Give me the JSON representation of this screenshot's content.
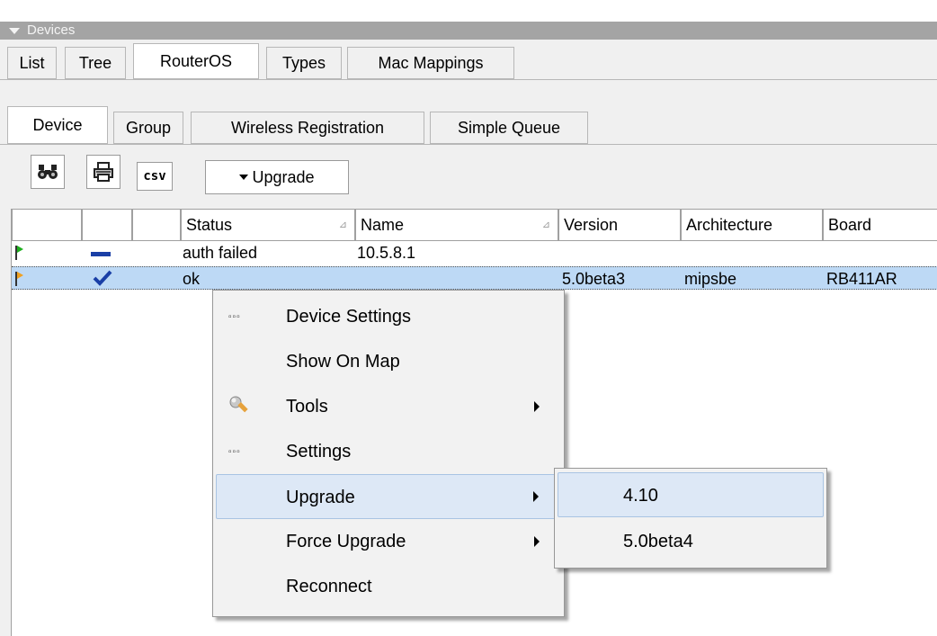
{
  "window": {
    "title": "Devices"
  },
  "tabs": [
    {
      "label": "List",
      "active": false
    },
    {
      "label": "Tree",
      "active": false
    },
    {
      "label": "RouterOS",
      "active": true
    },
    {
      "label": "Types",
      "active": false
    },
    {
      "label": "Mac Mappings",
      "active": false
    }
  ],
  "subtabs": [
    {
      "label": "Device",
      "active": true
    },
    {
      "label": "Group",
      "active": false
    },
    {
      "label": "Wireless Registration",
      "active": false
    },
    {
      "label": "Simple Queue",
      "active": false
    }
  ],
  "toolbar": {
    "find_icon": "binoculars-icon",
    "print_icon": "printer-icon",
    "csv_label": "csv",
    "upgrade_label": "Upgrade"
  },
  "table": {
    "columns": [
      "Status",
      "Name",
      "Version",
      "Architecture",
      "Board"
    ],
    "rows": [
      {
        "flag_color": "#1fb01f",
        "state_icon": "dash-icon",
        "status": "auth failed",
        "name": "10.5.8.1",
        "version": "",
        "architecture": "",
        "board": ""
      },
      {
        "flag_color": "#f0a020",
        "state_icon": "check-icon",
        "status": "ok",
        "name": "",
        "version": "5.0beta3",
        "architecture": "mipsbe",
        "board": "RB411AR"
      }
    ]
  },
  "context_menu": {
    "items": [
      {
        "label": "Device Settings",
        "icon": "dots-icon",
        "submenu": false
      },
      {
        "label": "Show On Map",
        "icon": "",
        "submenu": false
      },
      {
        "label": "Tools",
        "icon": "wrench-icon",
        "submenu": true
      },
      {
        "label": "Settings",
        "icon": "dots-icon",
        "submenu": false
      },
      {
        "label": "Upgrade",
        "icon": "",
        "submenu": true,
        "highlighted": true
      },
      {
        "label": "Force Upgrade",
        "icon": "",
        "submenu": true
      },
      {
        "label": "Reconnect",
        "icon": "",
        "submenu": false
      }
    ]
  },
  "upgrade_submenu": {
    "items": [
      {
        "label": "4.10",
        "highlighted": true
      },
      {
        "label": "5.0beta4",
        "highlighted": false
      }
    ]
  },
  "colors": {
    "title_bar": "#a4a4a4",
    "selection": "#bdd9f5",
    "menu_highlight": "#dde8f6",
    "check": "#1a3fa6"
  }
}
